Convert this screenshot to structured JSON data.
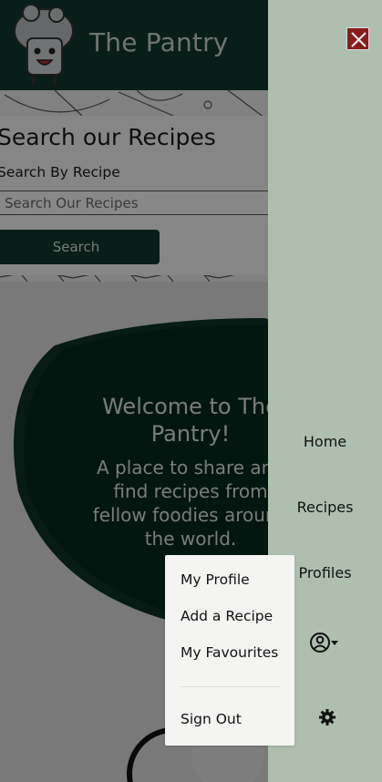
{
  "header": {
    "brand": "The Pantry",
    "logo_icon": "chef-hat-mascot-icon"
  },
  "search": {
    "title": "Search our Recipes",
    "label": "Search By Recipe",
    "placeholder": "Search Our Recipes",
    "button": "Search"
  },
  "hero": {
    "title": "Welcome to The Pantry!",
    "subtitle": "A place to share and find recipes from fellow foodies around the world."
  },
  "sidemenu": {
    "close_icon": "close-icon",
    "items": [
      {
        "label": "Home"
      },
      {
        "label": "Recipes"
      },
      {
        "label": "Profiles"
      }
    ],
    "profile_icon": "user-circle-caret-icon",
    "settings_icon": "gear-icon"
  },
  "dropdown": {
    "items": [
      {
        "label": "My Profile"
      },
      {
        "label": "Add a Recipe"
      },
      {
        "label": "My Favourites"
      }
    ],
    "signout": "Sign Out"
  },
  "colors": {
    "header_green": "#0d3a2c",
    "menu_bg": "#aebfb0",
    "close_red": "#8a1c1c"
  }
}
